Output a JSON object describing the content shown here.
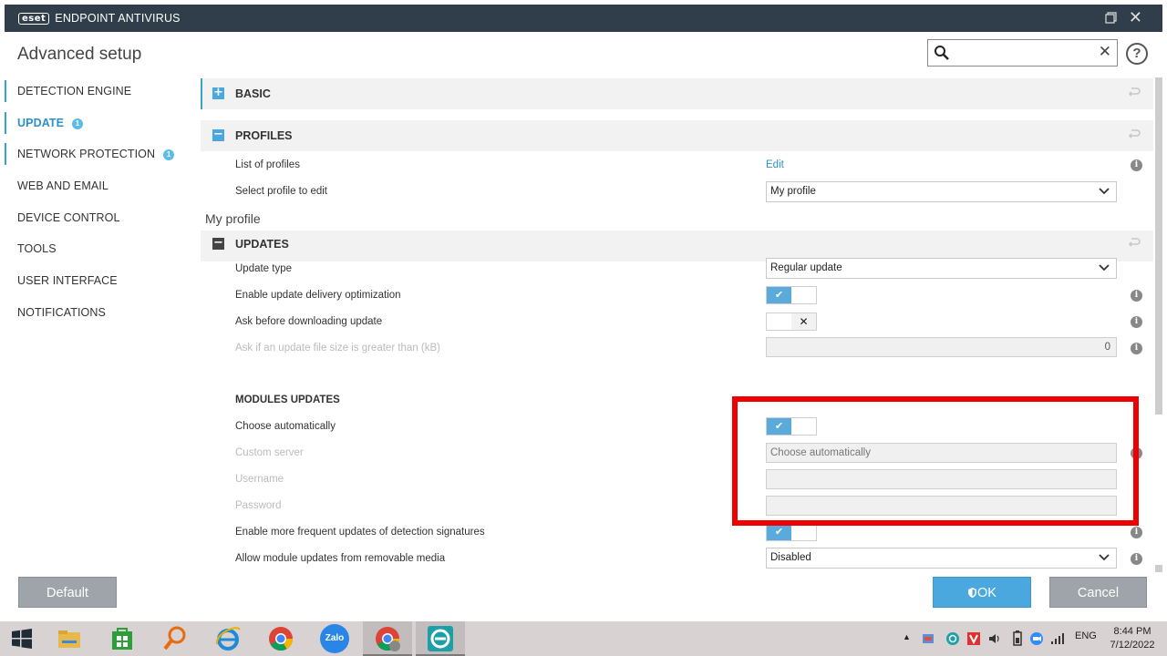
{
  "window": {
    "logo": "eset",
    "product": "ENDPOINT ANTIVIRUS"
  },
  "header": {
    "title": "Advanced setup",
    "search_value": "",
    "help": "?"
  },
  "sidebar": {
    "items": [
      {
        "label": "DETECTION ENGINE"
      },
      {
        "label": "UPDATE",
        "badge": "1"
      },
      {
        "label": "NETWORK PROTECTION",
        "badge": "1"
      },
      {
        "label": "WEB AND EMAIL"
      },
      {
        "label": "DEVICE CONTROL"
      },
      {
        "label": "TOOLS"
      },
      {
        "label": "USER INTERFACE"
      },
      {
        "label": "NOTIFICATIONS"
      }
    ]
  },
  "sections": {
    "basic": {
      "label": "BASIC",
      "toggle": "+"
    },
    "profiles": {
      "label": "PROFILES",
      "toggle": "−",
      "list_label": "List of profiles",
      "list_link": "Edit",
      "select_label": "Select profile to edit",
      "select_value": "My profile"
    },
    "profile_name": "My profile",
    "updates": {
      "label": "UPDATES",
      "toggle": "−",
      "update_type_label": "Update type",
      "update_type_value": "Regular update",
      "delivery_opt_label": "Enable update delivery optimization",
      "delivery_opt_on": true,
      "ask_before_label": "Ask before downloading update",
      "ask_before_on": false,
      "size_label": "Ask if an update file size is greater than (kB)",
      "size_value": "0"
    },
    "modules": {
      "title": "MODULES UPDATES",
      "choose_auto_label": "Choose automatically",
      "choose_auto_on": true,
      "custom_server_label": "Custom server",
      "custom_server_value": "Choose automatically",
      "username_label": "Username",
      "username_value": "",
      "password_label": "Password",
      "password_value": "",
      "frequent_label": "Enable more frequent updates of detection signatures",
      "frequent_on": true,
      "removable_label": "Allow module updates from removable media",
      "removable_value": "Disabled"
    }
  },
  "buttons": {
    "default": "Default",
    "ok": "OK",
    "cancel": "Cancel"
  },
  "taskbar": {
    "language": "ENG",
    "time": "8:44 PM",
    "date": "7/12/2022",
    "zalo_label": "Zalo"
  },
  "colors": {
    "accent": "#3ca0d5",
    "highlight": "#ee0000",
    "titlebar": "#2f3e4a"
  }
}
